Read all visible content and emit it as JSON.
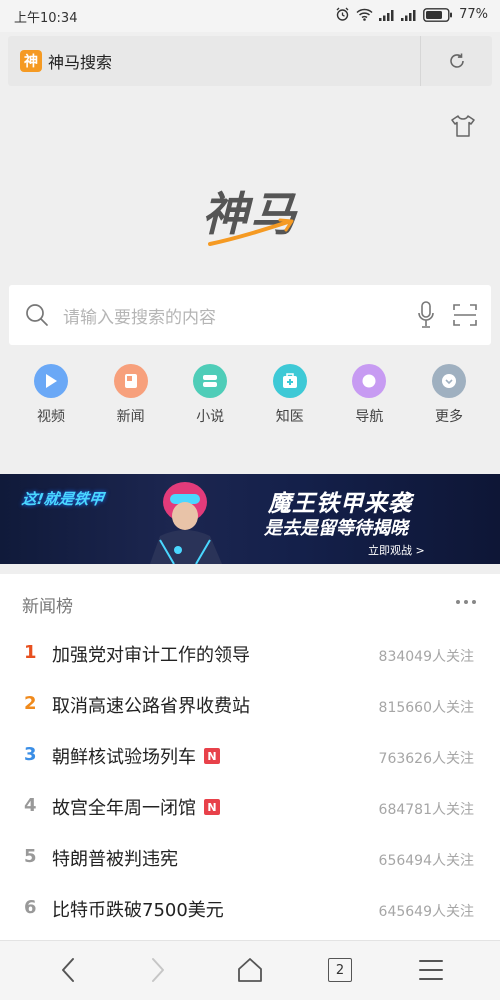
{
  "status_bar": {
    "time": "上午10:34",
    "battery": "77%"
  },
  "address_bar": {
    "logo_char": "神",
    "title": "神马搜索"
  },
  "brand": {
    "text": "神马"
  },
  "search": {
    "placeholder": "请输入要搜索的内容"
  },
  "quick_links": [
    {
      "label": "视频",
      "color": "#6aa8f6",
      "icon": "play-icon"
    },
    {
      "label": "新闻",
      "color": "#f7a07c",
      "icon": "news-icon"
    },
    {
      "label": "小说",
      "color": "#4fcdb8",
      "icon": "book-icon"
    },
    {
      "label": "知医",
      "color": "#3ec9d6",
      "icon": "medical-kit-icon"
    },
    {
      "label": "导航",
      "color": "#c79bf2",
      "icon": "navigation-icon"
    },
    {
      "label": "更多",
      "color": "#9fb0c0",
      "icon": "chevron-down-icon"
    }
  ],
  "banner": {
    "game_logo": "这!就是铁甲",
    "headline": "魔王铁甲来袭",
    "subheadline": "是去是留等待揭晓",
    "cta": "立即观战 >"
  },
  "news": {
    "title": "新闻榜",
    "items": [
      {
        "rank": "1",
        "rank_color": "#e8501f",
        "headline": "加强党对审计工作的领导",
        "followers": "834049人关注",
        "badge": ""
      },
      {
        "rank": "2",
        "rank_color": "#f08a1c",
        "headline": "取消高速公路省界收费站",
        "followers": "815660人关注",
        "badge": ""
      },
      {
        "rank": "3",
        "rank_color": "#3a8ee6",
        "headline": "朝鲜核试验场列车",
        "followers": "763626人关注",
        "badge": "N"
      },
      {
        "rank": "4",
        "rank_color": "#999999",
        "headline": "故宫全年周一闭馆",
        "followers": "684781人关注",
        "badge": "N"
      },
      {
        "rank": "5",
        "rank_color": "#999999",
        "headline": "特朗普被判违宪",
        "followers": "656494人关注",
        "badge": ""
      },
      {
        "rank": "6",
        "rank_color": "#999999",
        "headline": "比特币跌破7500美元",
        "followers": "645649人关注",
        "badge": ""
      }
    ]
  },
  "bottom_nav": {
    "tab_count": "2"
  }
}
